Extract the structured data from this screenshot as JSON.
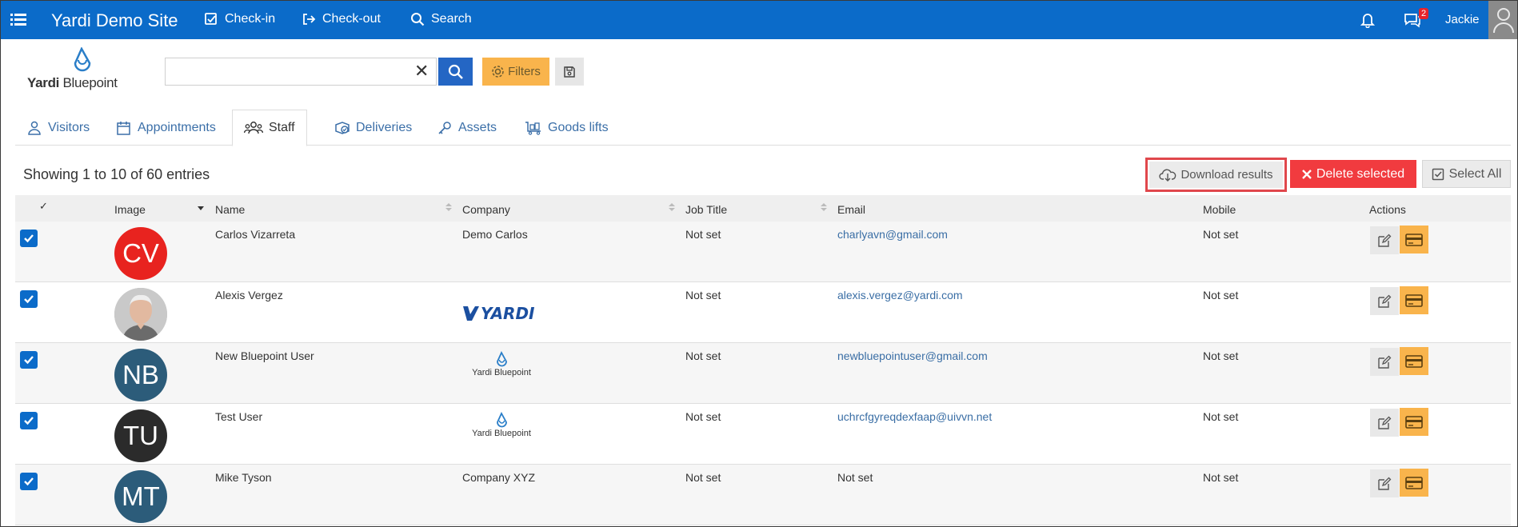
{
  "topbar": {
    "site_title": "Yardi Demo Site",
    "nav": [
      {
        "label": "Check-in",
        "icon": "checkbox-icon"
      },
      {
        "label": "Check-out",
        "icon": "sign-out-icon"
      },
      {
        "label": "Search",
        "icon": "search-icon"
      }
    ],
    "notification_icon": "bell-icon",
    "messages_icon": "chat-icon",
    "messages_badge": "2",
    "user_name": "Jackie",
    "avatar_icon": "user-avatar-icon"
  },
  "logo": {
    "text_bold": "Yardi",
    "text_rest": " Bluepoint"
  },
  "search": {
    "value": "",
    "placeholder": "",
    "filters_label": "Filters"
  },
  "tabs": [
    {
      "label": "Visitors",
      "icon": "visitor-icon"
    },
    {
      "label": "Appointments",
      "icon": "calendar-icon"
    },
    {
      "label": "Staff",
      "icon": "users-icon",
      "active": true
    },
    {
      "label": "Deliveries",
      "icon": "package-icon"
    },
    {
      "label": "Assets",
      "icon": "key-icon"
    },
    {
      "label": "Goods lifts",
      "icon": "trolley-icon"
    }
  ],
  "toolbar": {
    "entries_text": "Showing 1 to 10 of 60 entries",
    "download_label": "Download results",
    "delete_label": "Delete selected",
    "select_all_label": "Select All"
  },
  "table": {
    "check_header": "✓",
    "columns": [
      "Image",
      "Name",
      "Company",
      "Job Title",
      "Email",
      "Mobile",
      "Actions"
    ],
    "rows": [
      {
        "initials": "CV",
        "avatar_color": "#e8231f",
        "name": "Carlos Vizarreta",
        "company": "Demo Carlos",
        "job_title": "Not set",
        "email": "charlyavn@gmail.com",
        "mobile": "Not set"
      },
      {
        "initials": "",
        "avatar_color": "#b9b9b9",
        "name": "Alexis Vergez",
        "company": "YARDI",
        "job_title": "Not set",
        "email": "alexis.vergez@yardi.com",
        "mobile": "Not set"
      },
      {
        "initials": "NB",
        "avatar_color": "#2c5c7a",
        "name": "New Bluepoint User",
        "company": "Yardi Bluepoint",
        "job_title": "Not set",
        "email": "newbluepointuser@gmail.com",
        "mobile": "Not set"
      },
      {
        "initials": "TU",
        "avatar_color": "#2b2b2b",
        "name": "Test User",
        "company": "Yardi Bluepoint",
        "job_title": "Not set",
        "email": "uchrcfgyreqdexfaap@uivvn.net",
        "mobile": "Not set"
      },
      {
        "initials": "MT",
        "avatar_color": "#2c5c7a",
        "name": "Mike Tyson",
        "company": "Company XYZ",
        "job_title": "Not set",
        "email": "Not set",
        "mobile": "Not set"
      }
    ]
  },
  "colors": {
    "topbar": "#0b6bc9",
    "accent_orange": "#f9b44c",
    "delete_red": "#f13b3f",
    "link_blue": "#3a6ea5"
  }
}
